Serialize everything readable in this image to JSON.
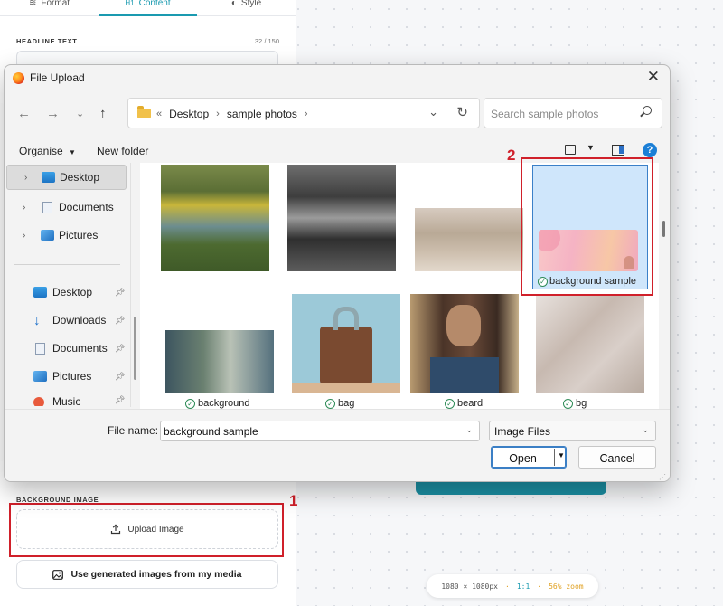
{
  "editor": {
    "tabs": [
      {
        "label": "Format",
        "icon": "layers-icon"
      },
      {
        "label": "Content",
        "icon": "heading-icon",
        "active": true
      },
      {
        "label": "Style",
        "icon": "palette-icon"
      }
    ],
    "headline_label": "HEADLINE TEXT",
    "headline_count": "32 / 150",
    "background_label": "BACKGROUND IMAGE",
    "upload_label": "Upload Image",
    "generated_label": "Use generated images from my media",
    "canvas_size": "1080 × 1080px",
    "ratio": "1:1",
    "zoom": "56% zoom",
    "separator": "·"
  },
  "annotations": {
    "step1": "1",
    "step2": "2",
    "color": "#d0202a"
  },
  "dialog": {
    "title": "File Upload",
    "close_glyph": "✕",
    "breadcrumb": {
      "prefix": "«",
      "items": [
        "Desktop",
        "sample photos"
      ],
      "separator": "›"
    },
    "search_placeholder": "Search sample photos",
    "organise_label": "Organise",
    "new_folder_label": "New folder",
    "help_label": "?",
    "nav_tree": [
      {
        "label": "Desktop",
        "icon": "desktop-icon",
        "selected": true
      },
      {
        "label": "Documents",
        "icon": "documents-icon"
      },
      {
        "label": "Pictures",
        "icon": "pictures-icon"
      }
    ],
    "quick_access": [
      {
        "label": "Desktop",
        "icon": "desktop-icon"
      },
      {
        "label": "Downloads",
        "icon": "downloads-icon"
      },
      {
        "label": "Documents",
        "icon": "documents-icon"
      },
      {
        "label": "Pictures",
        "icon": "pictures-icon"
      },
      {
        "label": "Music",
        "icon": "music-icon"
      }
    ],
    "files": [
      {
        "name": "",
        "state": "blurred"
      },
      {
        "name": "",
        "state": "blurred"
      },
      {
        "name": "",
        "state": "blurred"
      },
      {
        "name": "background sample",
        "state": "selected"
      },
      {
        "name": "background",
        "state": "blurred"
      },
      {
        "name": "bag",
        "state": "normal"
      },
      {
        "name": "beard",
        "state": "normal"
      },
      {
        "name": "bg",
        "state": "blurred"
      }
    ],
    "file_name_label": "File name:",
    "file_name_value": "background sample",
    "file_type_value": "Image Files",
    "open_label": "Open",
    "cancel_label": "Cancel",
    "accent_color": "#3b80c8"
  }
}
